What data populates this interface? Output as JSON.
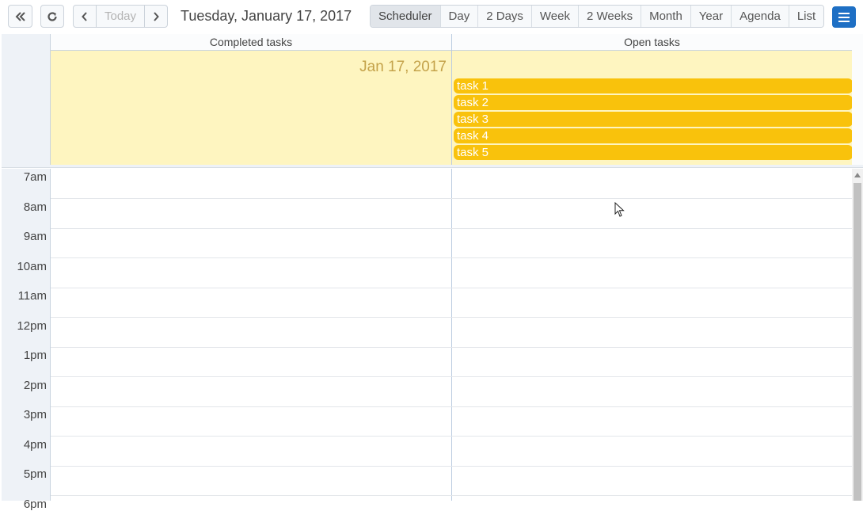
{
  "toolbar": {
    "prev_range_icon": "double-chevron-left-icon",
    "refresh_icon": "refresh-icon",
    "prev_icon": "chevron-left-icon",
    "today_label": "Today",
    "next_icon": "chevron-right-icon",
    "date_title": "Tuesday, January 17, 2017",
    "views": [
      "Scheduler",
      "Day",
      "2 Days",
      "Week",
      "2 Weeks",
      "Month",
      "Year",
      "Agenda",
      "List"
    ],
    "active_view": "Scheduler",
    "menu_icon": "hamburger-menu-icon",
    "accent": "#1e6fc4"
  },
  "calendar": {
    "columns": [
      "Completed tasks",
      "Open tasks"
    ],
    "allday_date": "Jan 17, 2017",
    "tasks": [
      "task 1",
      "task 2",
      "task 3",
      "task 4",
      "task 5"
    ],
    "task_color": "#f9c20c",
    "allday_color": "#fef5c0",
    "hours": [
      "7am",
      "8am",
      "9am",
      "10am",
      "11am",
      "12pm",
      "1pm",
      "2pm",
      "3pm",
      "4pm",
      "5pm",
      "6pm"
    ]
  }
}
